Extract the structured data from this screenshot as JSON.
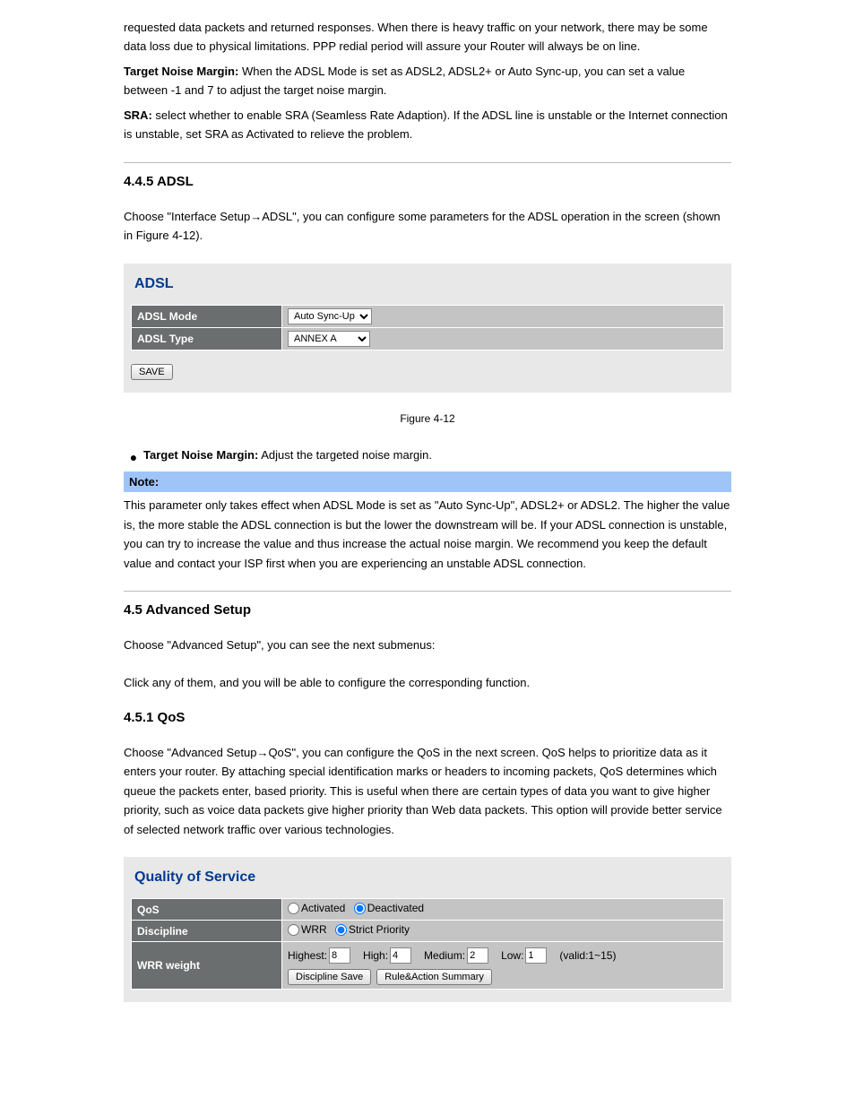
{
  "intro": {
    "para1_prefix": "requested data packets and returned responses. When there is heavy traffic on your network, there may be some data loss due to physical limitations. PPP redial period will assure your Router will always be on line.",
    "noise_margin_label": "Target Noise Margin:",
    "noise_margin_text": " When the ADSL Mode is set as ADSL2, ADSL2+ or Auto Sync-up, you can set a value between -1 and 7 to adjust the target noise margin.",
    "sra_label": "SRA:",
    "sra_text": " select whether to enable SRA (Seamless Rate Adaption). If the ADSL line is unstable or the Internet connection is unstable, set SRA as Activated to relieve the problem."
  },
  "adsl": {
    "heading": "4.4.5 ADSL",
    "intro": "Choose \"Interface Setup→ADSL\", you can configure some parameters for the ADSL operation in the screen (shown in Figure 4-12).",
    "panel_title": "ADSL",
    "mode_label": "ADSL Mode",
    "mode_value": "Auto Sync-Up",
    "type_label": "ADSL Type",
    "type_value": "ANNEX A",
    "save_label": "SAVE",
    "figure_caption": "Figure 4-12",
    "noise_bullet_label": "Target Noise Margin:",
    "noise_bullet_text": " Adjust the targeted noise margin.",
    "note_label": "Note:",
    "note_text": "This parameter only takes effect when ADSL Mode is set as \"Auto Sync-Up\", ADSL2+ or ADSL2. The higher the value is, the more stable the ADSL connection is but the lower the downstream will be. If your ADSL connection is unstable, you can try to increase the value and thus increase the actual noise margin. We recommend you keep the default value and contact your ISP first when you are experiencing an unstable ADSL connection."
  },
  "advanced": {
    "heading": "4.5 Advanced Setup",
    "intro": "Choose \"Advanced Setup\", you can see the next submenus:",
    "intro2": "Click any of them, and you will be able to configure the corresponding function."
  },
  "qos": {
    "heading": "4.5.1 QoS",
    "intro": "Choose \"Advanced Setup→QoS\", you can configure the QoS in the next screen. QoS helps to prioritize data as it enters your router. By attaching special identification marks or headers to incoming packets, QoS determines which queue the packets enter, based priority. This is useful when there are certain types of data you want to give higher priority, such as voice data packets give higher priority than Web data packets. This option will provide better service of selected network traffic over various technologies.",
    "panel_title": "Quality of Service",
    "row_qos_label": "QoS",
    "activated_label": "Activated",
    "deactivated_label": "Deactivated",
    "row_discipline_label": "Discipline",
    "wrr_label": "WRR",
    "strict_label": "Strict Priority",
    "row_wrrweight_label": "WRR weight",
    "highest_label": "Highest:",
    "highest_val": "8",
    "high_label": "High:",
    "high_val": "4",
    "medium_label": "Medium:",
    "medium_val": "2",
    "low_label": "Low:",
    "low_val": "1",
    "valid_label": "(valid:1~15)",
    "discipline_save": "Discipline Save",
    "rule_summary": "Rule&Action Summary"
  }
}
